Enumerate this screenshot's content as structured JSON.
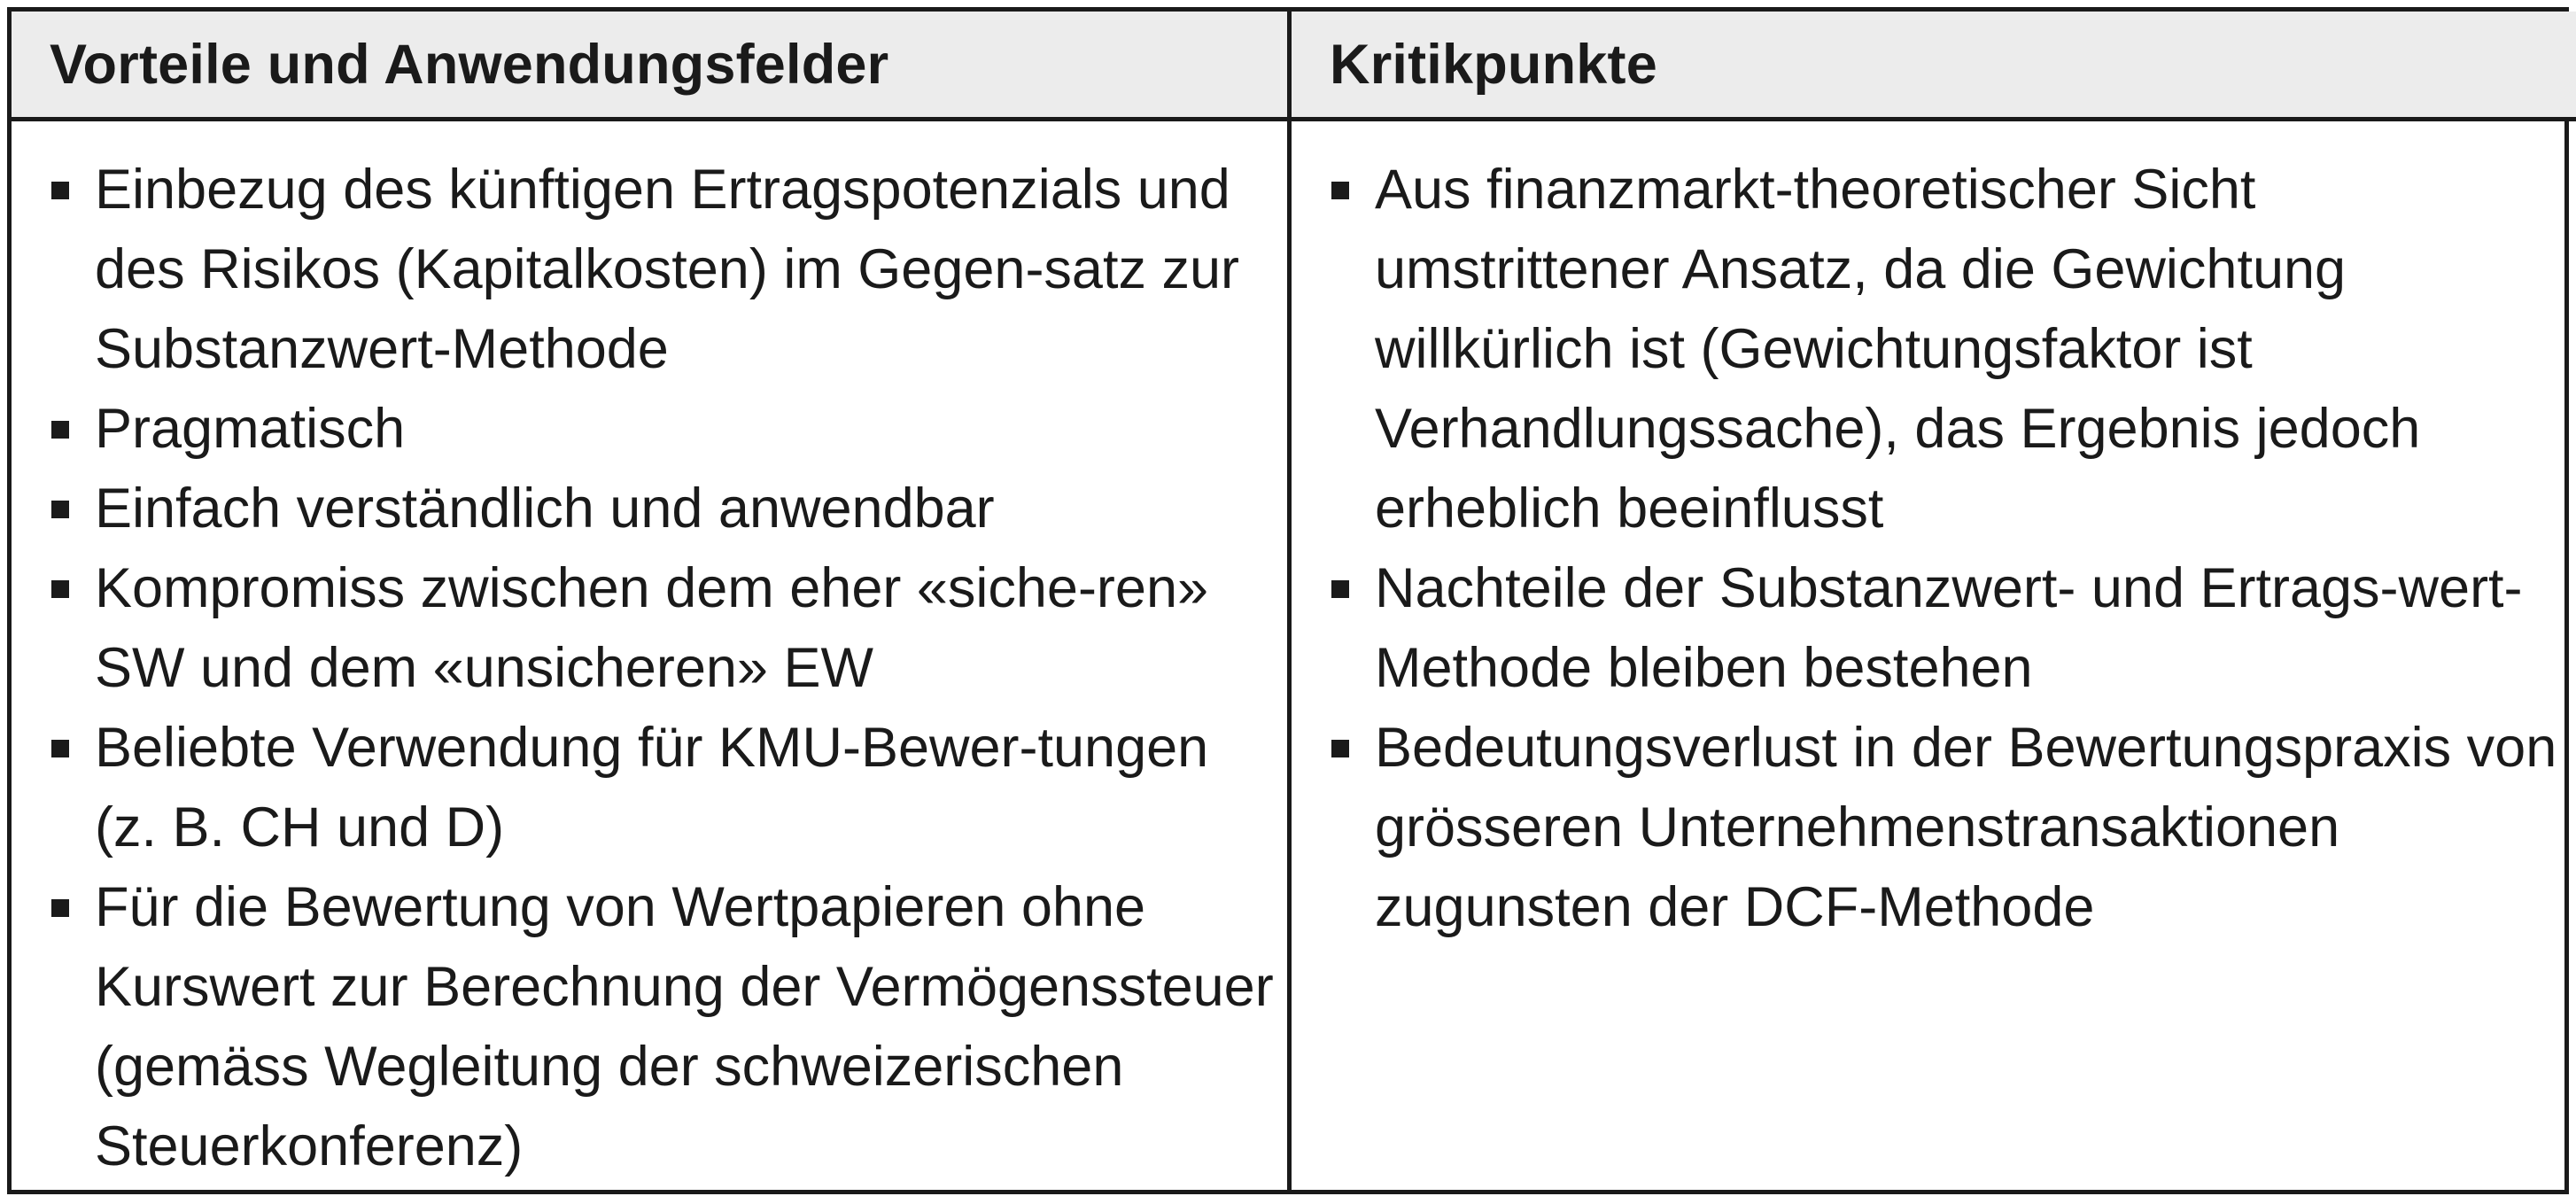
{
  "table": {
    "headers": {
      "left": "Vorteile und Anwendungsfelder",
      "right": "Kritikpunkte"
    },
    "left_items": [
      "Einbezug des künftigen Ertragspotenzials und des Risikos (Kapitalkosten) im Gegen-satz zur Substanzwert-Methode",
      "Pragmatisch",
      "Einfach verständlich und anwendbar",
      "Kompromiss zwischen dem eher «siche-ren» SW und dem «unsicheren» EW",
      "Beliebte Verwendung für KMU-Bewer-tungen (z. B. CH und D)",
      "Für die Bewertung von Wertpapieren ohne Kurswert zur Berechnung der Vermögenssteuer (gemäss Wegleitung der schweizerischen Steuerkonferenz)"
    ],
    "right_items": [
      "Aus finanzmarkt-theoretischer Sicht umstrittener Ansatz, da die Gewichtung willkürlich ist (Gewichtungsfaktor ist Verhandlungssache), das Ergebnis jedoch erheblich beeinflusst",
      "Nachteile der Substanzwert- und Ertrags-wert-Methode bleiben bestehen",
      "Bedeutungsverlust in der Bewertungspraxis von grösseren Unternehmenstransaktionen zugunsten der DCF-Methode"
    ]
  }
}
